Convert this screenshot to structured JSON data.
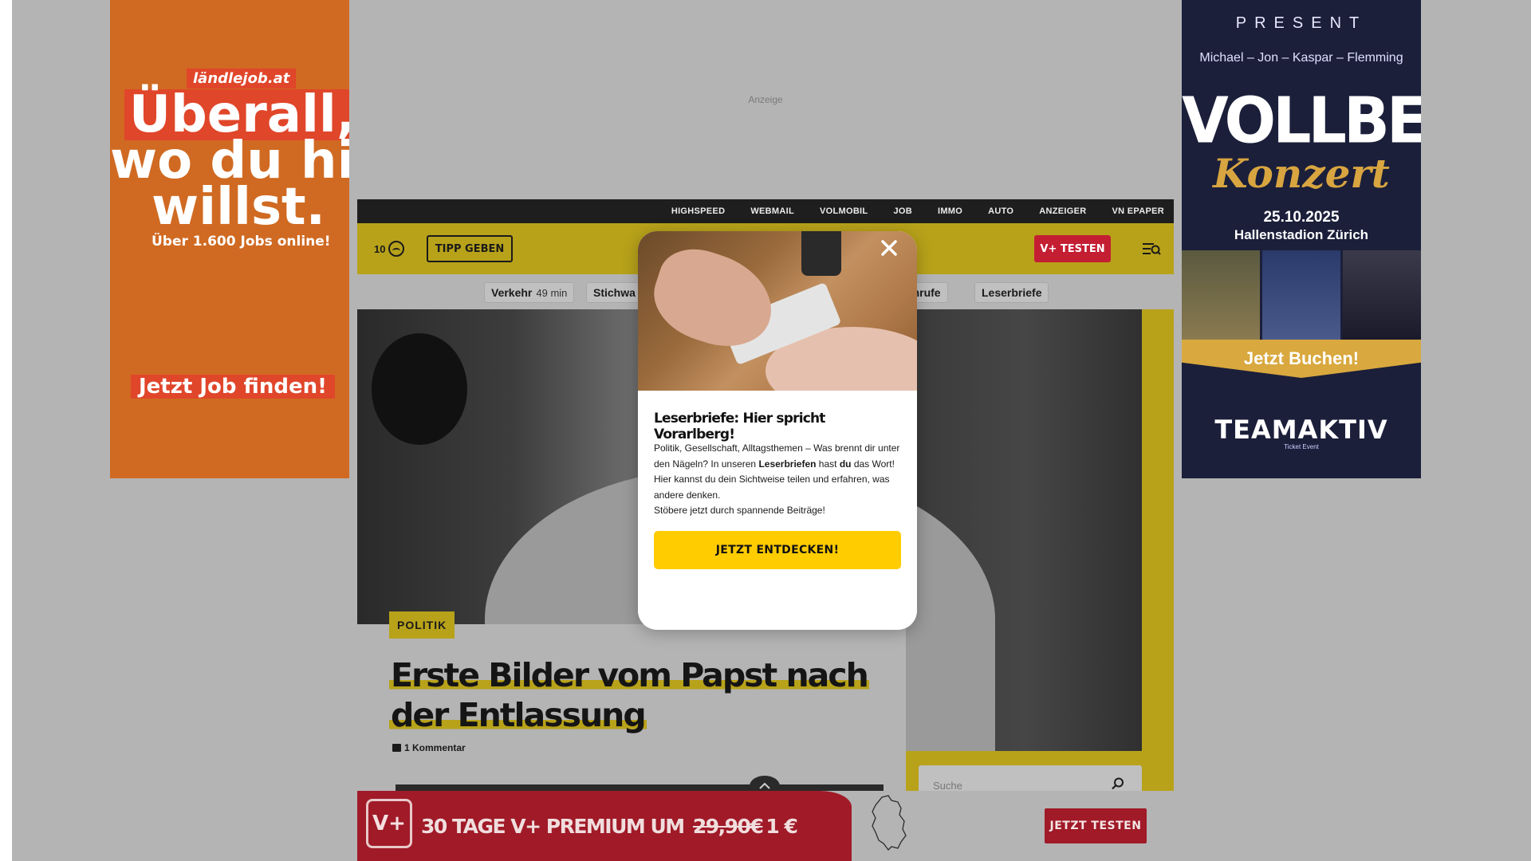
{
  "top_ad": {
    "label": "Anzeige"
  },
  "left_ad": {
    "brand": "ländlejob.at",
    "line1": "Überall,",
    "line2": "wo du hin",
    "line3": "willst.",
    "subline": "Über 1.600 Jobs online!",
    "cta": "Jetzt Job finden!",
    "colors": {
      "background": "#d06a22",
      "accent": "#e0462a"
    }
  },
  "right_ad": {
    "present": "PRESENT",
    "names": "Michael – Jon – Kaspar – Flemming",
    "band": "VOLLBEAT",
    "event": "Konzert",
    "date": "25.10.2025",
    "venue": "Hallenstadion Zürich",
    "cta": "Jetzt Buchen!",
    "sponsor": "TEAMAKTIV",
    "sponsor_sub": "Ticket Event"
  },
  "topbar": {
    "links": [
      "HIGHSPEED",
      "WEBMAIL",
      "VOLMOBIL",
      "JOB",
      "IMMO",
      "AUTO",
      "ANZEIGER",
      "VN EPAPER"
    ]
  },
  "header": {
    "temperature": "10",
    "weather_icon": "cloud-circle-icon",
    "tipp_button": "TIPP GEBEN",
    "vplus_button": "V+ TESTEN",
    "menu_icon": "menu-search-icon",
    "colors": {
      "brand_yellow": "#b8a21a",
      "vplus_red": "#c41e33"
    }
  },
  "tags": {
    "traffic_label": "Verkehr",
    "traffic_minutes": "49 min",
    "stichwort": "Stichwa",
    "nachrufe": "achrufe",
    "leserbriefe": "Leserbriefe"
  },
  "article": {
    "kicker": "POLITIK",
    "headline": "Erste Bilder vom Papst nach der Entlassung",
    "comments": "1 Kommentar"
  },
  "sidebar": {
    "search_placeholder": "Suche"
  },
  "promo": {
    "logo": "V+",
    "text_prefix": "30 TAGE V+ PREMIUM UM",
    "old_price": "29,90€",
    "new_price": "1 €",
    "button": "JETZT TESTEN",
    "colors": {
      "red": "#a01a28"
    }
  },
  "modal": {
    "title": "Leserbriefe: Hier spricht Vorarlberg!",
    "body_part1": "Politik, Gesellschaft, Alltagsthemen – Was brennt dir unter den Nägeln? In unseren ",
    "body_bold1": "Leserbriefen",
    "body_part2": " hast ",
    "body_bold2": "du",
    "body_part3": " das Wort! Hier kannst du dein Sichtweise teilen und erfahren, was andere denken.",
    "body_line2": "Stöbere jetzt durch spannende Beiträge!",
    "cta": "JETZT ENTDECKEN!",
    "close_icon": "close-icon",
    "colors": {
      "cta": "#ffcc00"
    }
  }
}
